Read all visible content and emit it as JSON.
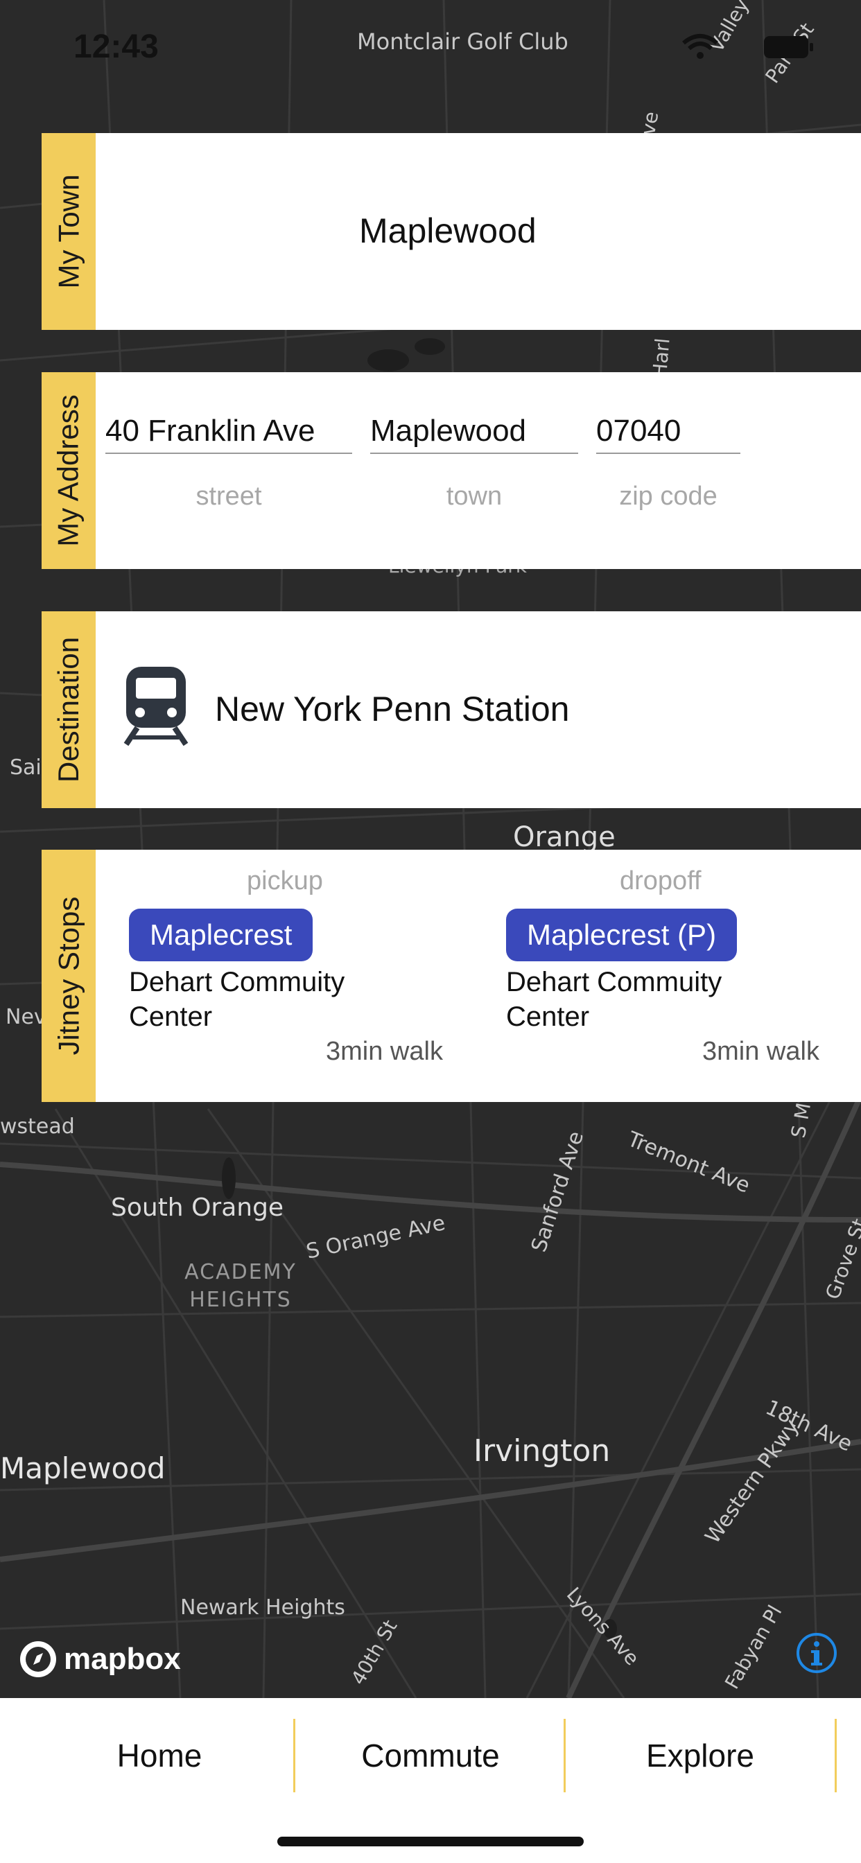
{
  "status": {
    "time": "12:43"
  },
  "map": {
    "labels": [
      "Montclair Golf Club",
      "Llewellyn Park",
      "Orange",
      "South Orange",
      "ACADEMY HEIGHTS",
      "S Orange Ave",
      "Sanford Ave",
      "Tremont Ave",
      "Irvington",
      "Maplewood",
      "Newark Heights",
      "40th St",
      "Lyons Ave",
      "Western Pkwy",
      "18th Ave",
      "Grove St",
      "Fabyan Pl",
      "Ave",
      "Valley",
      "Park St",
      "Harl",
      "Sai",
      "Nev",
      "wstead",
      "S M"
    ],
    "attribution": "mapbox"
  },
  "my_town": {
    "tab_label": "My Town",
    "value": "Maplewood"
  },
  "my_address": {
    "tab_label": "My Address",
    "street": "40 Franklin Ave",
    "street_label": "street",
    "town": "Maplewood",
    "town_label": "town",
    "zip": "07040",
    "zip_label": "zip code"
  },
  "destination": {
    "tab_label": "Destination",
    "icon": "train-icon",
    "value": "New York Penn Station"
  },
  "jitney_stops": {
    "tab_label": "Jitney Stops",
    "pickup": {
      "label": "pickup",
      "stop": "Maplecrest",
      "address": "Dehart Commuity Center",
      "walk": "3min walk"
    },
    "dropoff": {
      "label": "dropoff",
      "stop": "Maplecrest (P)",
      "address": "Dehart Commuity Center",
      "walk": "3min walk"
    }
  },
  "tabs": {
    "home": "Home",
    "commute": "Commute",
    "explore": "Explore"
  },
  "colors": {
    "accent": "#f2cd5c",
    "pill": "#3a49bb",
    "map_bg": "#2a2a2a",
    "info": "#1e88e5"
  }
}
